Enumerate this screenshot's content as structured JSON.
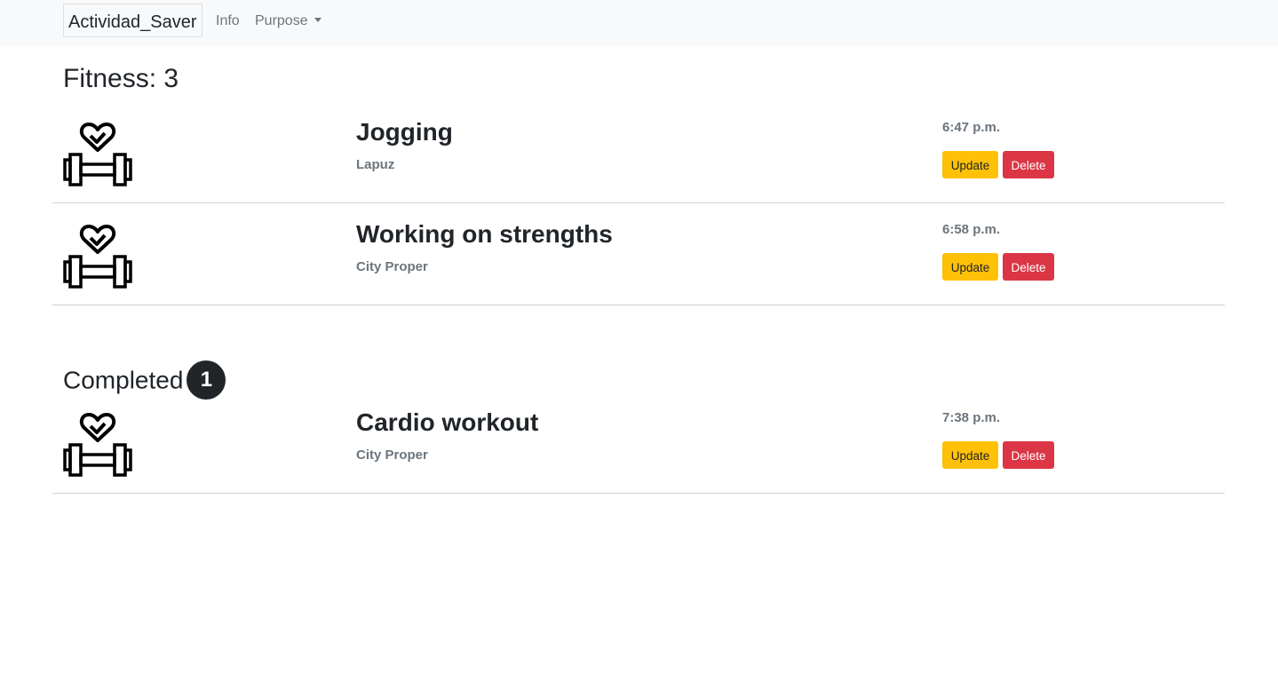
{
  "navbar": {
    "brand": "Actividad_Saver",
    "links": [
      {
        "label": "Info"
      },
      {
        "label": "Purpose"
      }
    ]
  },
  "fitness": {
    "title": "Fitness: 3",
    "items": [
      {
        "title": "Jogging",
        "place": "Lapuz",
        "time": "6:47 p.m.",
        "update_label": "Update",
        "delete_label": "Delete"
      },
      {
        "title": "Working on strengths",
        "place": "City Proper",
        "time": "6:58 p.m.",
        "update_label": "Update",
        "delete_label": "Delete"
      }
    ]
  },
  "completed": {
    "title": "Completed",
    "count": "1",
    "items": [
      {
        "title": "Cardio workout",
        "place": "City Proper",
        "time": "7:38 p.m.",
        "update_label": "Update",
        "delete_label": "Delete"
      }
    ]
  },
  "icons": {
    "activity_icon": "heart-dumbbell-icon",
    "dropdown_icon": "caret-down-icon"
  },
  "colors": {
    "navbar_bg": "#f8f9fa",
    "update": "#ffc107",
    "delete": "#dc3545",
    "badge": "#212529",
    "muted": "#6c757d"
  }
}
